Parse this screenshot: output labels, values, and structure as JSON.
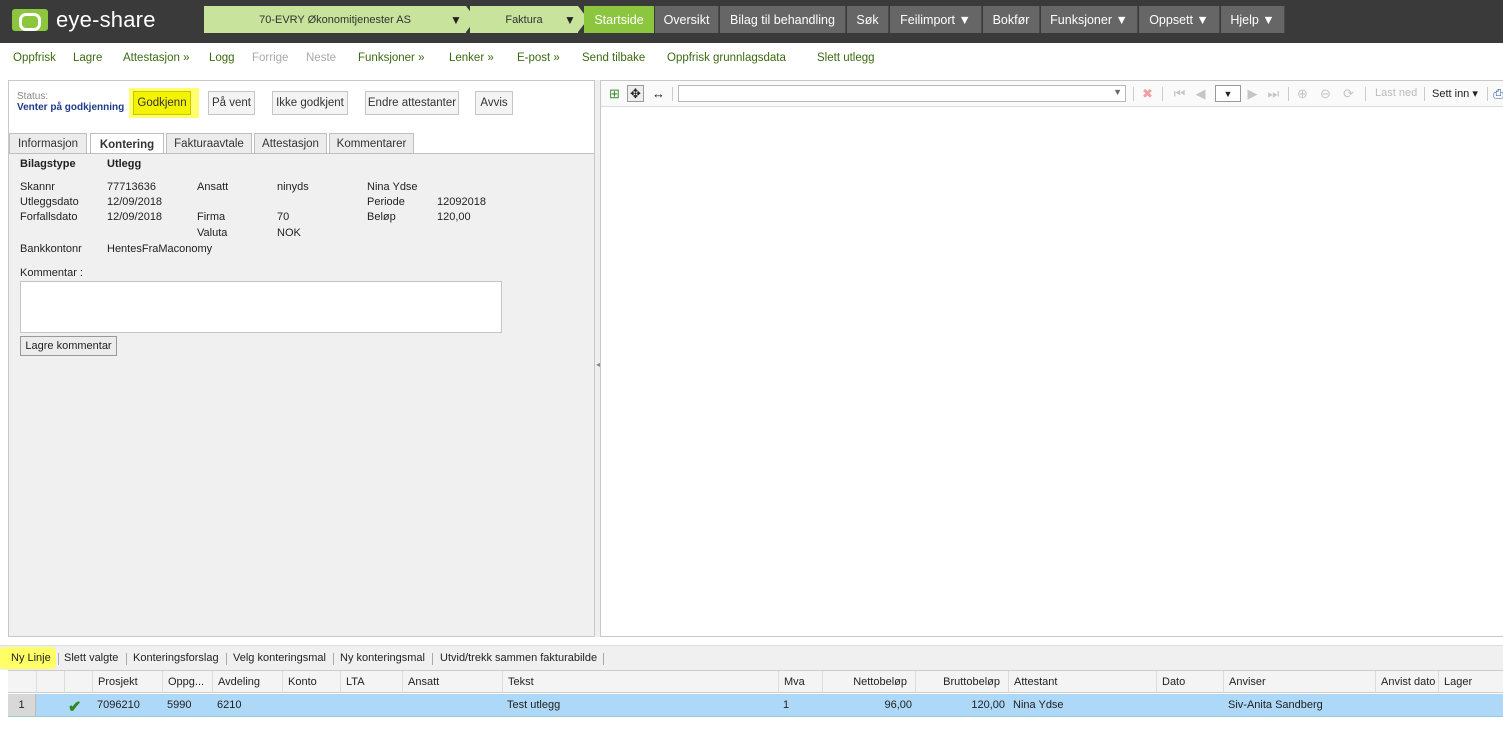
{
  "app": {
    "name": "eye-share"
  },
  "breadcrumbs": [
    {
      "label": "70-EVRY Økonomitjenester AS"
    },
    {
      "label": "Faktura"
    }
  ],
  "dropdown_glyph": "▼",
  "nav": {
    "startside": "Startside",
    "oversikt": "Oversikt",
    "bilag": "Bilag til behandling",
    "sok": "Søk",
    "feilimport": "Feilimport ▼",
    "bokfor": "Bokfør",
    "funksjoner": "Funksjoner ▼",
    "oppsett": "Oppsett ▼",
    "hjelp": "Hjelp ▼"
  },
  "toolbar": {
    "oppfrisk": "Oppfrisk",
    "lagre": "Lagre",
    "attestasjon": "Attestasjon »",
    "logg": "Logg",
    "forrige": "Forrige",
    "neste": "Neste",
    "funksjoner": "Funksjoner »",
    "lenker": "Lenker »",
    "epost": "E-post »",
    "send_tilbake": "Send tilbake",
    "oppfrisk_grunnlag": "Oppfrisk grunnlagsdata",
    "slett_utlegg": "Slett utlegg"
  },
  "status": {
    "label": "Status:",
    "value": "Venter på godkjenning"
  },
  "actions": {
    "godkjenn": "Godkjenn",
    "pa_vent": "På vent",
    "ikke_godkjent": "Ikke godkjent",
    "endre_attestanter": "Endre attestanter",
    "avvis": "Avvis"
  },
  "tabs": {
    "informasjon": "Informasjon",
    "kontering": "Kontering",
    "fakturaavtale": "Fakturaavtale",
    "attestasjon": "Attestasjon",
    "kommentarer": "Kommentarer"
  },
  "details": {
    "bilagstype_label": "Bilagstype",
    "bilagstype_value": "Utlegg",
    "skannr_label": "Skannr",
    "skannr_value": "77713636",
    "ansatt_label": "Ansatt",
    "ansatt_value": "ninyds",
    "ansatt_name": "Nina Ydse",
    "utleggsdato_label": "Utleggsdato",
    "utleggsdato_value": "12/09/2018",
    "periode_label": "Periode",
    "periode_value": "12092018",
    "forfallsdato_label": "Forfallsdato",
    "forfallsdato_value": "12/09/2018",
    "firma_label": "Firma",
    "firma_value": "70",
    "belop_label": "Beløp",
    "belop_value": "120,00",
    "valuta_label": "Valuta",
    "valuta_value": "NOK",
    "bankkontonr_label": "Bankkontonr",
    "bankkontonr_value": "HentesFraMaconomy",
    "kommentar_label": "Kommentar :",
    "lagre_kommentar": "Lagre kommentar"
  },
  "viewer": {
    "page_glyph": "▼",
    "last_ned": "Last ned",
    "sett_inn": "Sett inn ▾"
  },
  "grid_toolbar": {
    "ny_linje": "Ny Linje",
    "slett_valgte": "Slett valgte",
    "konteringsforslag": "Konteringsforslag",
    "velg_mal": "Velg konteringsmal",
    "ny_mal": "Ny konteringsmal",
    "utvid": "Utvid/trekk sammen fakturabilde"
  },
  "grid": {
    "columns": [
      "Prosjekt",
      "Oppg...",
      "Avdeling",
      "Konto",
      "LTA",
      "Ansatt",
      "Tekst",
      "Mva",
      "Nettobeløp",
      "Bruttobeløp",
      "Attestant",
      "Dato",
      "Anviser",
      "Anvist dato",
      "Lager"
    ],
    "rows": [
      {
        "num": "1",
        "prosjekt": "7096210",
        "oppg": "5990",
        "avdeling": "6210",
        "konto": "",
        "lta": "",
        "ansatt": "",
        "tekst": "Test utlegg",
        "mva": "1",
        "netto": "96,00",
        "brutto": "120,00",
        "attestant": "Nina Ydse",
        "dato": "",
        "anviser": "Siv-Anita Sandberg",
        "anvist_dato": "",
        "lager": ""
      }
    ]
  },
  "colors": {
    "brand_green": "#8cc63f",
    "crumb_green": "#c7e39c",
    "highlight": "#ffff66",
    "row_selected": "#add8f7"
  }
}
